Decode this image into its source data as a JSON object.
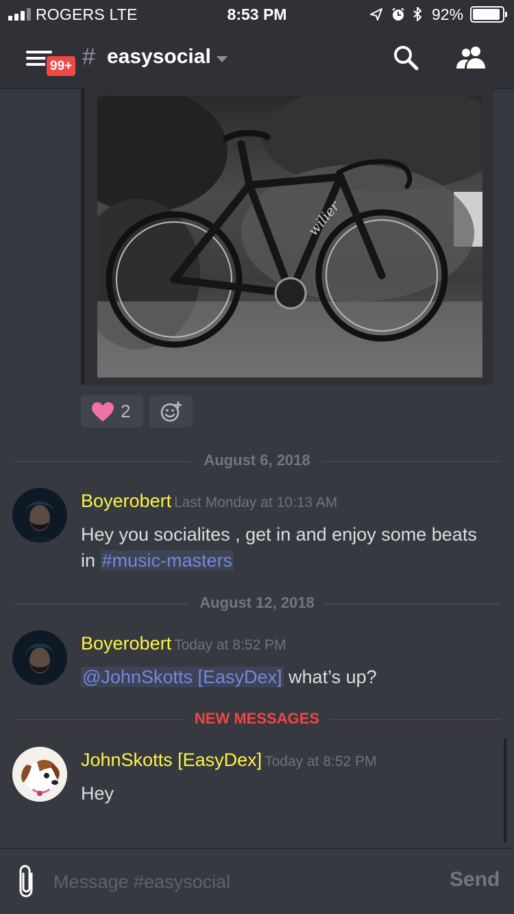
{
  "status_bar": {
    "carrier": "ROGERS  LTE",
    "time": "8:53 PM",
    "battery_percent": "92%",
    "battery_level": 0.92,
    "icons": [
      "location-arrow-icon",
      "alarm-icon",
      "bluetooth-icon"
    ]
  },
  "header": {
    "unread_badge": "99+",
    "channel_prefix": "#",
    "channel_name": "easysocial"
  },
  "reactions": [
    {
      "emoji": "heart",
      "count": "2"
    },
    {
      "emoji": "add-reaction"
    }
  ],
  "dividers": {
    "date1": "August 6, 2018",
    "date2": "August 12, 2018",
    "new_messages": "NEW MESSAGES"
  },
  "messages": [
    {
      "author": "Boyerobert",
      "timestamp": "Last Monday at 10:13 AM",
      "text_line1": "Hey you socialites , get in and enjoy some beats",
      "text_pre": "in ",
      "channel_link": "#music-masters"
    },
    {
      "author": "Boyerobert",
      "timestamp": "Today at 8:52 PM",
      "mention": "@JohnSkotts [EasyDex]",
      "text": " what’s up?"
    },
    {
      "author": "JohnSkotts [EasyDex]",
      "timestamp": "Today at 8:52 PM",
      "text": "Hey"
    }
  ],
  "composer": {
    "placeholder": "Message #easysocial",
    "send_label": "Send"
  },
  "colors": {
    "background": "#36393f",
    "header": "#2f3136",
    "author": "#fff346",
    "mention": "#7289da",
    "new_messages": "#f04747"
  }
}
